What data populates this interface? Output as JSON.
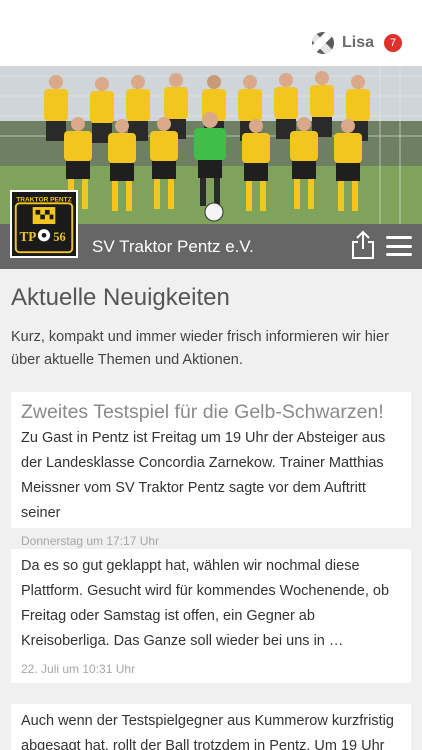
{
  "user": {
    "name": "Lisa",
    "notifications": "7",
    "logo_icon": "app-logo-icon"
  },
  "club": {
    "name": "SV Traktor Pentz e.V.",
    "crest_text_top": "TRAKTOR PENTZ",
    "crest_text_tp": "TP",
    "crest_text_year": "56"
  },
  "section": {
    "title": "Aktuelle Neuigkeiten",
    "intro": "Kurz, kompakt und immer wieder frisch informieren wir hier über aktuelle Themen und Aktionen."
  },
  "news": [
    {
      "title": "Zweites Testspiel für die Gelb-Schwarzen!",
      "text": "Zu Gast in Pentz ist Freitag um 19 Uhr der Absteiger aus der Landesklasse Concordia Zarnekow. Trainer Matthias Meissner vom SV Traktor Pentz sagte vor dem Auftritt seiner",
      "date": "Donnerstag um 17:17 Uhr"
    },
    {
      "title": "",
      "text": "Da es so gut geklappt hat, wählen wir nochmal diese Plattform. Gesucht wird für kommendes Wochenende, ob Freitag oder Samstag ist offen, ein Gegner ab Kreisoberliga. Das Ganze soll wieder bei uns in …",
      "date": "22. Juli um 10:31 Uhr"
    },
    {
      "title": "",
      "text": "Auch wenn der Testspielgegner aus Kummerow kurzfristig abgesagt hat, rollt der Ball trotzdem in Pentz. Um 19 Uhr",
      "date": ""
    }
  ],
  "colors": {
    "badge": "#e0302b",
    "club_bar": "#666666",
    "jersey": "#f2c61f",
    "keeper": "#3fbf4a"
  }
}
